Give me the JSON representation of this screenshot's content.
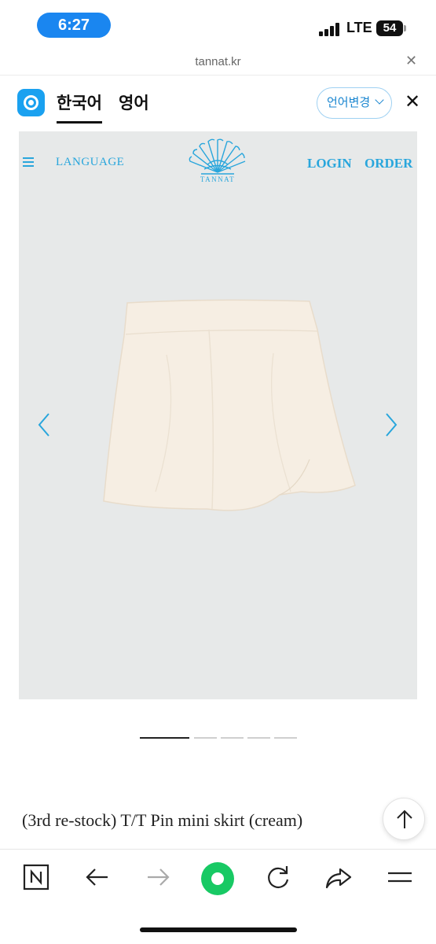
{
  "status_bar": {
    "time": "6:27",
    "network": "LTE",
    "battery": "54"
  },
  "url_bar": {
    "url": "tannat.kr",
    "close_glyph": "✕"
  },
  "translate_bar": {
    "source_lang": "한국어",
    "target_lang": "영어",
    "change_label": "언어변경",
    "close_glyph": "✕",
    "accent_color": "#1a86d0"
  },
  "site": {
    "brand": "TANNAT",
    "nav": {
      "language": "LANGUAGE",
      "login": "LOGIN",
      "order": "ORDER"
    },
    "accent_color": "#29a6dc",
    "gallery": {
      "slide_count": 5,
      "active_slide": 1
    },
    "product_title": "(3rd re-stock) T/T Pin mini skirt (cream)"
  },
  "icons": {
    "menu": "hamburger-icon",
    "prev": "chevron-left-icon",
    "next": "chevron-right-icon",
    "scroll_top": "arrow-up-icon",
    "toolbar": [
      "naver-n-icon",
      "back-arrow-icon",
      "forward-arrow-icon",
      "green-home-icon",
      "refresh-icon",
      "share-icon",
      "menu-lines-icon"
    ]
  }
}
